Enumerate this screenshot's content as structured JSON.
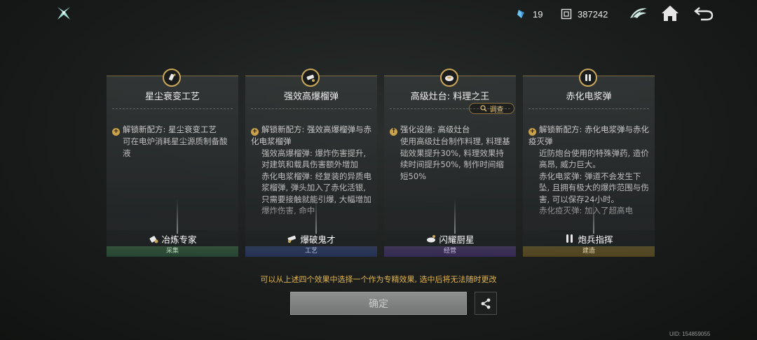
{
  "topbar": {
    "crystal_count": "19",
    "coin_count": "387242",
    "icons": [
      "logo-icon",
      "crystal-icon",
      "coin-icon",
      "wing-emblem-icon",
      "home-icon",
      "back-arrow-icon"
    ]
  },
  "cards": [
    {
      "title": "星尘衰变工艺",
      "lead": "解锁新配方: 星尘衰变工艺",
      "body": "可在电炉消耗星尘源质制备酸液",
      "role": "冶炼专家",
      "category": "采集",
      "category_color": "#4a7a55"
    },
    {
      "title": "强效高爆榴弹",
      "lead": "解锁新配方: 强效高爆榴弹与赤化电浆榴弹",
      "body": "强效高爆榴弹: 爆炸伤害提升, 对建筑和载具伤害额外增加\n赤化电浆榴弹: 经复装的异质电浆榴弹, 弹头加入了赤化活银, 只需要接触就能引爆, 大幅增加爆炸伤害, 命中",
      "role": "爆破鬼才",
      "category": "工艺",
      "category_color": "#3e5490"
    },
    {
      "title": "高级灶台: 料理之王",
      "lead": "强化设施: 高级灶台",
      "body": "使用高级灶台制作料理, 料理基础效果提升30%, 料理效果持续时间提升50%, 制作时间缩短50%",
      "role": "闪耀厨星",
      "category": "经营",
      "category_color": "#5c4690",
      "inspect_label": "调查"
    },
    {
      "title": "赤化电浆弹",
      "lead": "解锁新配方: 赤化电浆弹与赤化疫灭弹",
      "body": "近防炮台使用的特殊弹药, 造价高昂, 威力巨大。\n赤化电浆弹: 弹道不会发生下坠, 且拥有极大的爆炸范围与伤害, 可以保存24小时。\n赤化疫灭弹: 加入了超高电",
      "role": "炮兵指挥",
      "category": "建造",
      "category_color": "#8a7430"
    }
  ],
  "hint": "可以从上述四个效果中选择一个作为专精效果, 选中后将无法随时更改",
  "confirm_label": "确定",
  "uid_label": "UID: 154859055",
  "accent_gold": "#caa85a"
}
